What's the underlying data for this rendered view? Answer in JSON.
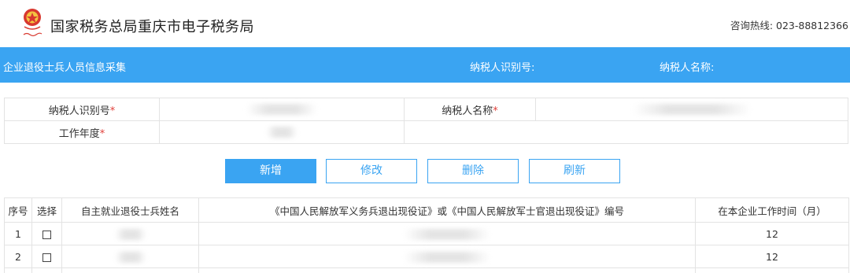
{
  "header": {
    "title": "国家税务总局重庆市电子税务局",
    "hotline": "咨询热线: 023-88812366"
  },
  "bluebar": {
    "page_title": "企业退役士兵人员信息采集",
    "taxpayer_id_label": "纳税人识别号:",
    "taxpayer_name_label": "纳税人名称:"
  },
  "info_form": {
    "taxpayer_id_label": "纳税人识别号",
    "taxpayer_name_label": "纳税人名称",
    "work_year_label": "工作年度",
    "required_mark": "*"
  },
  "toolbar": {
    "add_label": "新增",
    "edit_label": "修改",
    "delete_label": "删除",
    "refresh_label": "刷新"
  },
  "table": {
    "headers": {
      "seq": "序号",
      "select": "选择",
      "name": "自主就业退役士兵姓名",
      "cert_no": "《中国人民解放军义务兵退出现役证》或《中国人民解放军士官退出现役证》编号",
      "months": "在本企业工作时间（月）"
    },
    "rows": [
      {
        "seq": "1",
        "months": "12"
      },
      {
        "seq": "2",
        "months": "12"
      }
    ]
  },
  "colors": {
    "accent": "#3aa4f2",
    "required": "#e0403a"
  }
}
